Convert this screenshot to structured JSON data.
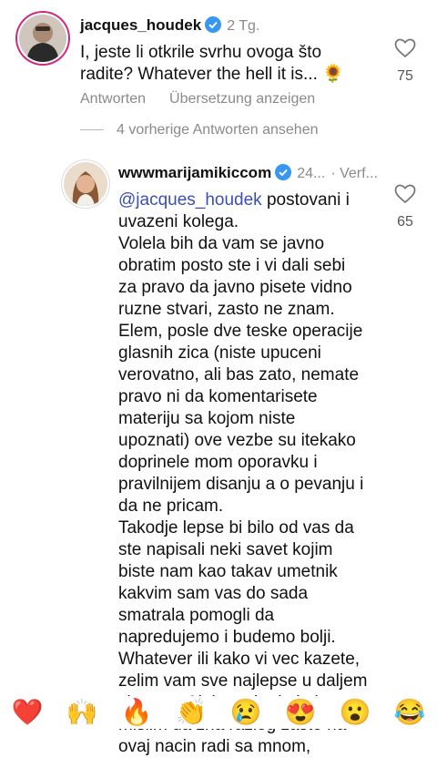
{
  "comment1": {
    "username": "jacques_houdek",
    "time": "2 Tg.",
    "text_lines": [
      "I, jeste li otkrile svrhu ovoga što",
      "radite? Whatever the hell it is... 🌻"
    ],
    "reply_label": "Antworten",
    "translate_label": "Übersetzung anzeigen",
    "like_count": "75"
  },
  "more_replies_label": "4 vorherige Antworten ansehen",
  "comment2": {
    "username": "wwwmarijamikiccom",
    "time": "24...",
    "extra": "· Verf...",
    "mention": "@jacques_houdek",
    "first_line_rest": " postovani i",
    "text_lines": [
      "uvazeni kolega.",
      "Volela bih da vam se javno",
      "obratim posto ste i vi dali sebi",
      "za pravo da javno pisete vidno",
      "ruzne stvari, zasto ne znam.",
      "Elem, posle dve teske operacije",
      "glasnih zica (niste upuceni",
      "verovatno, ali bas zato, nemate",
      "pravo ni da komentarisete",
      "materiju sa kojom niste",
      "upoznati) ove vezbe su itekako",
      "doprinele mom oporavku i",
      "pravilnijem disanju a o pevanju i",
      "da ne pricam.",
      "Takodje lepse bi bilo od vas da",
      "ste napisali neki savet kojim",
      "biste nam kao takav umetnik",
      "kakvim sam vas do sada",
      "smatrala pomogli da",
      "napredujemo i budemo bolji.",
      "Whatever ili kako vi vec kazete,",
      "zelim vam sve najlepse u daljem",
      "zivotu, a Aleksandra itekako",
      "mislim da zna razlog zasto na",
      "ovaj nacin radi sa mnom,"
    ],
    "like_count": "65"
  },
  "emoji_bar": [
    "❤️",
    "🙌",
    "🔥",
    "👏",
    "😢",
    "😍",
    "😮",
    "😂"
  ],
  "colors": {
    "verified": "#3897f0",
    "mention": "#3b4fb3",
    "muted": "#8a8a8a"
  }
}
